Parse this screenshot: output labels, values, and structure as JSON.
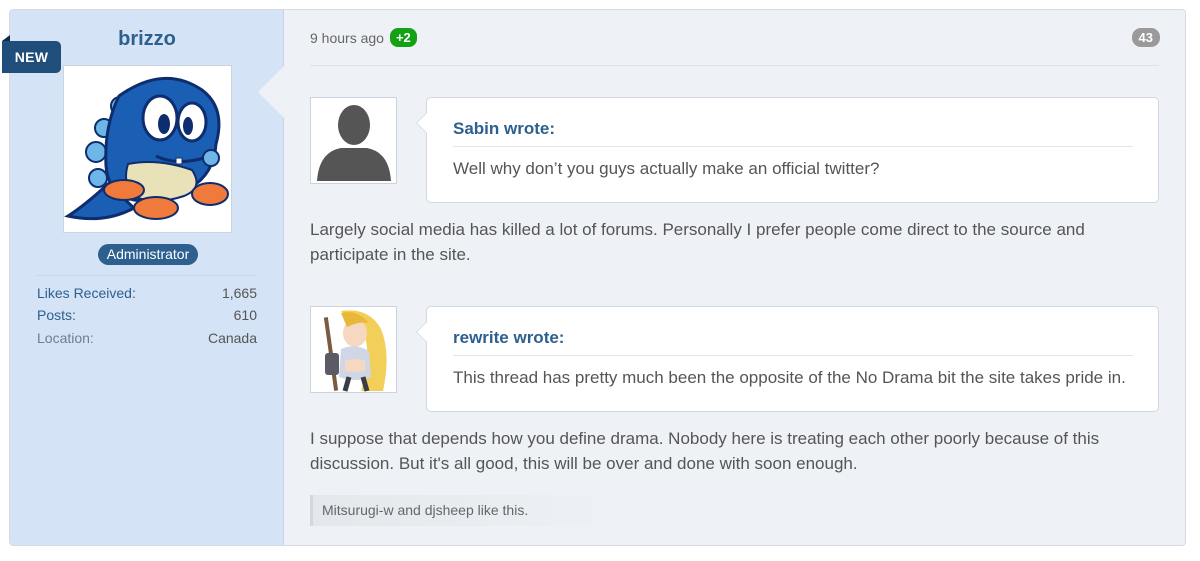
{
  "user": {
    "name": "brizzo",
    "new_badge": "NEW",
    "role": "Administrator",
    "stats": [
      {
        "label": "Likes Received:",
        "value": "1,665"
      },
      {
        "label": "Posts:",
        "value": "610"
      },
      {
        "label": "Location:",
        "value": "Canada"
      }
    ]
  },
  "post": {
    "time": "9 hours ago",
    "rating": "+2",
    "number": "43",
    "quotes": [
      {
        "author": "Sabin wrote:",
        "text": "Well why don’t you guys actually make an official twitter?",
        "avatar": "default-silhouette"
      },
      {
        "author": "rewrite wrote:",
        "text": "This thread has pretty much been the opposite of the No Drama bit the site takes pride in.",
        "avatar": "anime-character"
      }
    ],
    "replies": [
      "Largely social media has killed a lot of forums. Personally I prefer people come direct to the source and participate in the site.",
      "I suppose that depends how you define drama. Nobody here is treating each other poorly because of this discussion. But it's all good, this will be over and done with soon enough."
    ],
    "likes_text": "Mitsurugi-w and djsheep like this."
  },
  "colors": {
    "sidebar_bg": "#d4e3f5",
    "link": "#2d5f8f",
    "badge_new": "#1f4e7a",
    "rating_green": "#15a115"
  }
}
